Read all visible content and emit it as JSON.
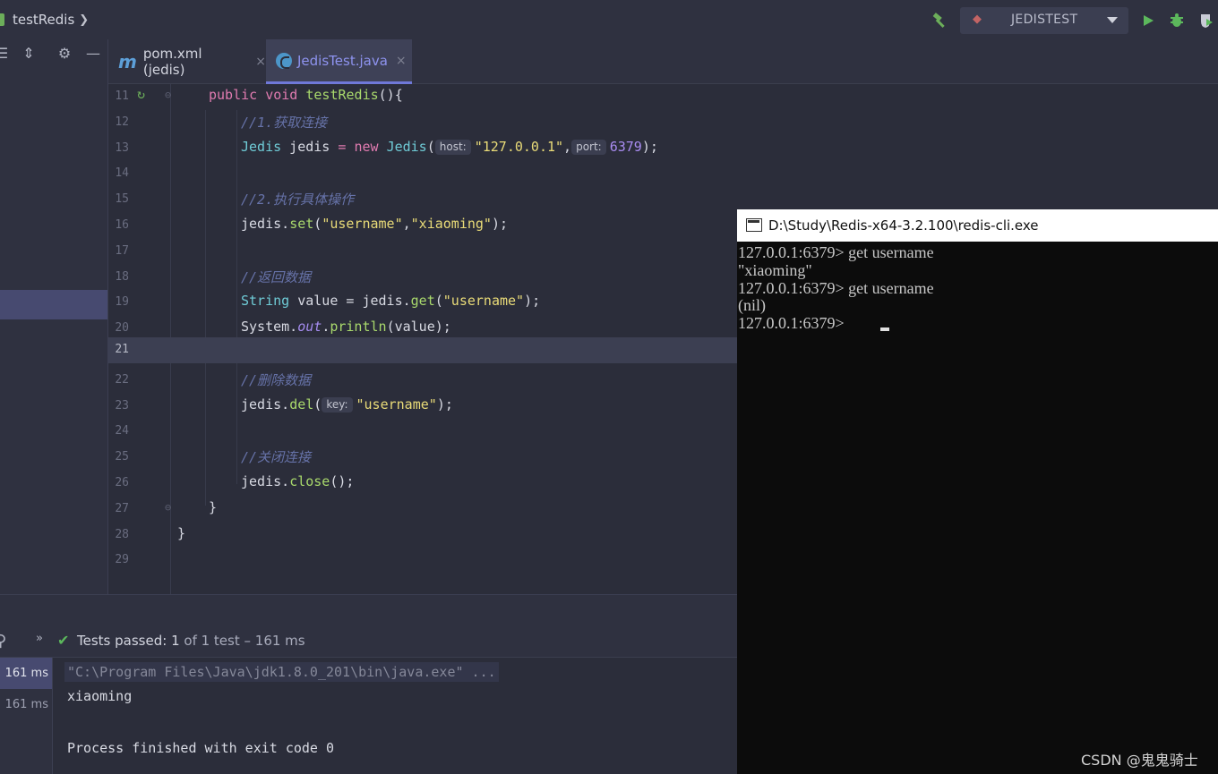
{
  "project": {
    "name": "testRedis"
  },
  "run_config": {
    "label": "JEDISTEST"
  },
  "tabs": [
    {
      "icon": "m",
      "label": "pom.xml (jedis)",
      "close": "×"
    },
    {
      "label": "JedisTest.java",
      "close": "×"
    }
  ],
  "editor": {
    "line_numbers": [
      "11",
      "12",
      "13",
      "14",
      "15",
      "16",
      "17",
      "18",
      "19",
      "20",
      "21",
      "22",
      "23",
      "24",
      "25",
      "26",
      "27",
      "28",
      "29"
    ],
    "hints": {
      "host": "host:",
      "port": "port:",
      "key": "key:"
    },
    "tokens": {
      "l11_public": "public",
      "l11_void": "void",
      "l11_name": "testRedis",
      "l11_rest": "(){",
      "l12_comment": "//1.获取连接",
      "l13_type": "Jedis",
      "l13_var": " jedis ",
      "l13_eq": "= ",
      "l13_new": "new",
      "l13_cls": "Jedis",
      "l13_open": "(",
      "l13_host": "\"127.0.0.1\"",
      "l13_comma": ",",
      "l13_port": "6379",
      "l13_close": ");",
      "l15_comment": "//2.执行具体操作",
      "l16_obj": "jedis.",
      "l16_fn": "set",
      "l16_open": "(",
      "l16_arg1": "\"username\"",
      "l16_comma": ",",
      "l16_arg2": "\"xiaoming\"",
      "l16_close": ");",
      "l18_comment": "//返回数据",
      "l19_type": "String",
      "l19_var": " value = jedis.",
      "l19_fn": "get",
      "l19_open": "(",
      "l19_arg": "\"username\"",
      "l19_close": ");",
      "l20_obj": "System.",
      "l20_out": "out",
      "l20_dot": ".",
      "l20_fn": "println",
      "l20_rest": "(value);",
      "l22_comment": "//删除数据",
      "l23_obj": "jedis.",
      "l23_fn": "del",
      "l23_open": "(",
      "l23_arg": "\"username\"",
      "l23_close": ");",
      "l25_comment": "//关闭连接",
      "l26_obj": "jedis.",
      "l26_fn": "close",
      "l26_rest": "();",
      "l27_brace": "}",
      "l28_brace": "}"
    }
  },
  "test_run": {
    "status_prefix": "Tests passed:",
    "passed": "1",
    "status_suffix": "of 1 test – 161 ms",
    "tree": [
      "161 ms",
      "161 ms"
    ],
    "console": [
      "\"C:\\Program Files\\Java\\jdk1.8.0_201\\bin\\java.exe\" ...",
      "xiaoming",
      "Process finished with exit code 0"
    ]
  },
  "cmd_window": {
    "title": "D:\\Study\\Redis-x64-3.2.100\\redis-cli.exe",
    "lines": [
      "127.0.0.1:6379> get username",
      "\"xiaoming\"",
      "127.0.0.1:6379> get username",
      "(nil)",
      "127.0.0.1:6379> "
    ]
  },
  "watermark": "CSDN @鬼鬼骑士",
  "colors": {
    "accent": "#6f78d8",
    "selection": "#474a70",
    "pass_green": "#5cb85c"
  },
  "icons": {
    "topbar": [
      "hammer-icon",
      "run-icon",
      "debug-icon",
      "coverage-icon"
    ],
    "left_tools": [
      "expand-all-icon",
      "collapse-all-icon",
      "gear-icon",
      "minimize-icon"
    ]
  }
}
